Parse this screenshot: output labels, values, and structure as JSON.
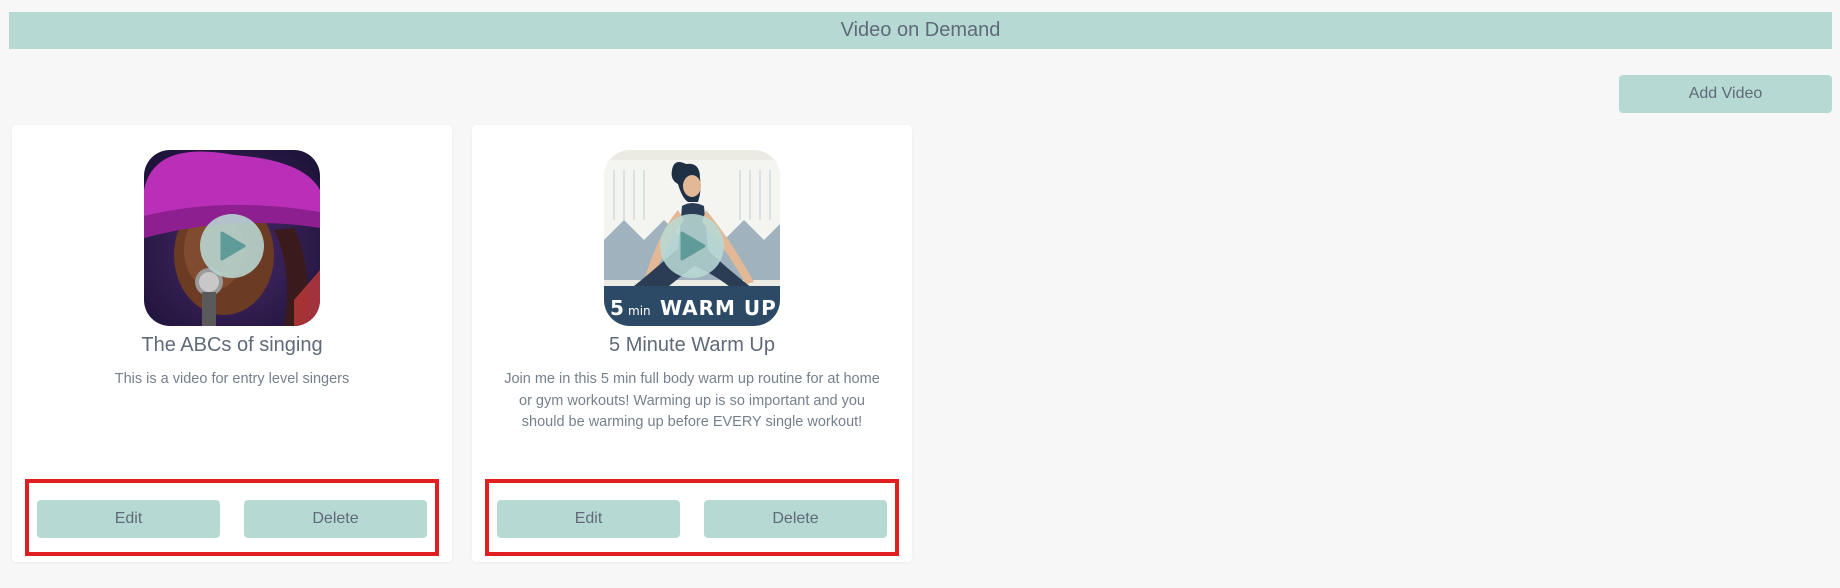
{
  "header": {
    "title": "Video on Demand"
  },
  "toolbar": {
    "add_video_label": "Add Video"
  },
  "videos": [
    {
      "title": "The ABCs of singing",
      "description": "This is a video for entry level singers",
      "thumbnail_icon": "singer-thumbnail",
      "edit_label": "Edit",
      "delete_label": "Delete"
    },
    {
      "title": "5 Minute Warm Up",
      "description": "Join me in this 5 min full body warm up routine for at home or gym workouts! Warming up is so important and you should be warming up before EVERY single workout!",
      "thumbnail_icon": "yoga-warmup-thumbnail",
      "thumbnail_caption": {
        "num": "5",
        "unit": "min",
        "text": "WARM UP"
      },
      "edit_label": "Edit",
      "delete_label": "Delete"
    }
  ],
  "colors": {
    "accent": "#b6d9d4",
    "text": "#5f6a78",
    "highlight": "#e02020",
    "background": "#f7f7f7"
  }
}
